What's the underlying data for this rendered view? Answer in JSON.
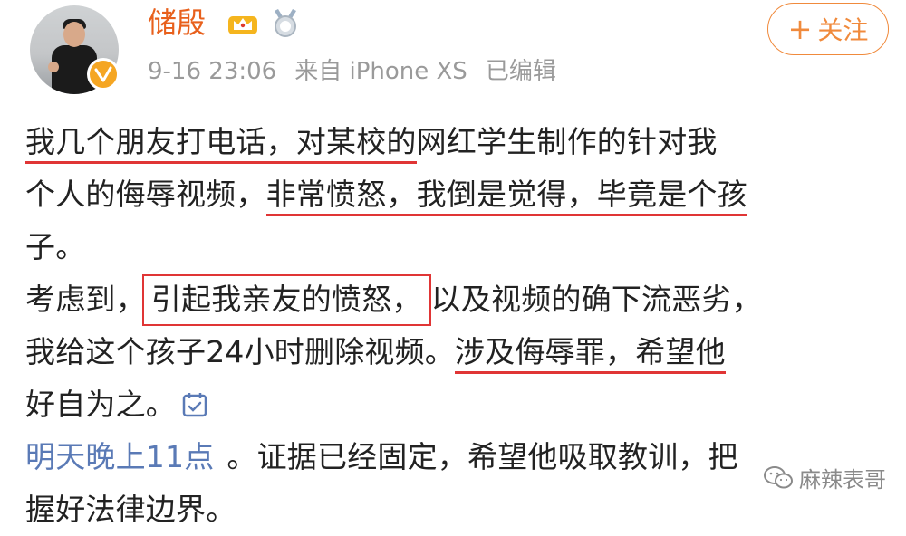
{
  "post": {
    "author": "储殷",
    "timestamp": "9-16 23:06",
    "source": "来自 iPhone XS",
    "edited": "已编辑",
    "follow_label": "关注"
  },
  "content": {
    "l1_a": "我几个朋友打电话，对某校的",
    "l1_b": "网红学生制作的针对我",
    "l2_a": "个人的侮辱视频，",
    "l2_b": "非常愤怒，我倒是觉得，毕竟是个孩",
    "l3": "子。",
    "l4_a": "考虑到，",
    "l4_b": "引起我亲友的愤怒，",
    "l4_c": "以及视频的确下流恶劣，",
    "l5_a": "我给这个孩子24小时删除视频。",
    "l5_b": "涉及侮辱罪，希望他",
    "l6": "好自为之。",
    "topic": "明天晚上11点",
    "l7_rest": "。证据已经固定，希望他吸取教训，把",
    "l8": "握好法律边界。"
  },
  "watermark": "麻辣表哥",
  "icons": {
    "verified": "verified-badge-icon",
    "crown": "vip-crown-icon",
    "medal": "medal-icon",
    "edit": "calendar-edit-icon",
    "watermark": "wechat-icon"
  },
  "colors": {
    "username": "#e8601c",
    "follow": "#f08a3c",
    "topic": "#5a7ab6",
    "highlight": "#e03535",
    "meta": "#9a9a9a"
  }
}
